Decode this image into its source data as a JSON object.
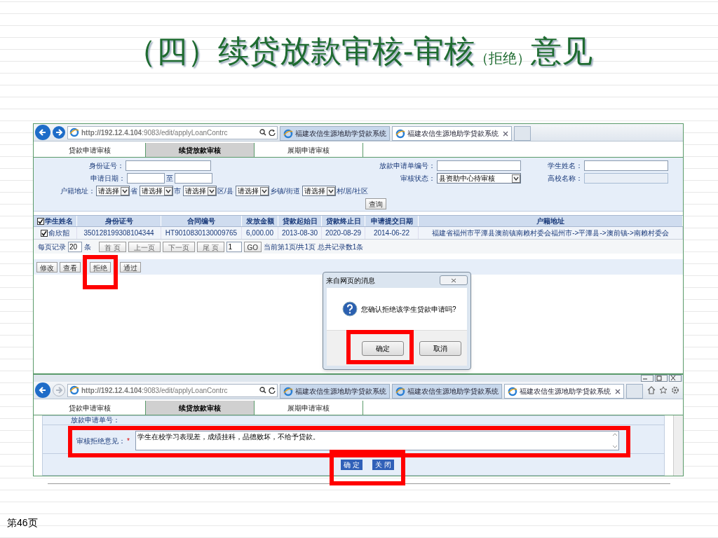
{
  "slide": {
    "title": "（四）续贷放款审核-审核",
    "title_note": "（拒绝）",
    "title_end": "意见",
    "page": "第46页"
  },
  "screen1": {
    "url": "**http://192.12.4.104**:9083/edit/applyLoanContrc",
    "browser_tabs": [
      {
        "label": "福建农信生源地助学贷款系统",
        "selected": false
      },
      {
        "label": "福建农信生源地助学贷款系统",
        "selected": true
      }
    ],
    "nav_tabs": [
      {
        "label": "贷款申请审核",
        "selected": false
      },
      {
        "label": "续贷放款审核",
        "selected": true
      },
      {
        "label": "展期申请审核",
        "selected": false
      }
    ],
    "filter_rows": [
      [
        {
          "label": "身份证号：",
          "kind": "input",
          "disabled": false
        },
        {
          "label": "放款申请单编号：",
          "kind": "input",
          "disabled": false
        },
        {
          "label": "学生姓名：",
          "kind": "input",
          "disabled": false
        }
      ],
      [
        {
          "label": "申请日期：",
          "kind": "range",
          "separator": "至",
          "disabled": false
        },
        {
          "label": "审核状态：",
          "kind": "select",
          "value": "县资助中心待审核",
          "disabled": false
        },
        {
          "label": "高校名称：",
          "kind": "input",
          "disabled": true
        }
      ]
    ],
    "address": {
      "label": "户籍地址：",
      "parts": [
        {
          "value": "请选择",
          "suffix": "省"
        },
        {
          "value": "请选择",
          "suffix": "市"
        },
        {
          "value": "请选择",
          "suffix": "区/县"
        },
        {
          "value": "请选择",
          "suffix": "乡镇/街道"
        },
        {
          "value": "请选择",
          "suffix": "村/居/社区"
        }
      ]
    },
    "search_button": "查询",
    "table": {
      "all_checked": true,
      "columns": [
        "学生姓名",
        "身份证号",
        "合同编号",
        "发放金额",
        "贷款起始日",
        "贷款终止日",
        "申请提交日期",
        "户籍地址"
      ],
      "rows": [
        {
          "checked": true,
          "cells": [
            "俞欣韶",
            "350128199308104344",
            "HT9010830130009765",
            "6,000.00",
            "2013-08-30",
            "2020-08-29",
            "2014-06-22",
            "福建省福州市平潭县澳前镇南赖村委会福州市->平潭县->澳前镇->南赖村委会"
          ]
        }
      ]
    },
    "pager": {
      "per_page_label": "每页记录",
      "per_page": "20",
      "unit": "条",
      "buttons": [
        "首 页",
        "上一页",
        "下一页",
        "尾 页"
      ],
      "page": "1",
      "go": "GO",
      "summary": "当前第1页/共1页 总共记录数1条"
    },
    "actions": [
      "修改",
      "查看",
      "拒绝",
      "通过"
    ],
    "dialog": {
      "title": "来自网页的消息",
      "message": "您确认拒绝该学生贷款申请吗?",
      "buttons": [
        "确定",
        "取消"
      ]
    }
  },
  "screen2": {
    "url": "**http://192.12.4.104**:9083/edit/applyLoanContrc",
    "browser_tabs": [
      {
        "label": "福建农信生源地助学贷款系统",
        "selected": false
      },
      {
        "label": "福建农信生源地助学贷款系统",
        "selected": false
      },
      {
        "label": "福建农信生源地助学贷款系统",
        "selected": true
      }
    ],
    "nav_tabs": [
      {
        "label": "贷款申请审核",
        "selected": false
      },
      {
        "label": "续贷放款审核",
        "selected": true
      },
      {
        "label": "展期申请审核",
        "selected": false
      }
    ],
    "form": {
      "number_label": "放款申请单号：",
      "opinion_label": "审核拒绝意见：",
      "required_mark": "*",
      "opinion": "学生在校学习表现差，成绩挂科，品德败坏，不给予贷款。"
    },
    "buttons": [
      "确 定",
      "关 闭"
    ]
  }
}
